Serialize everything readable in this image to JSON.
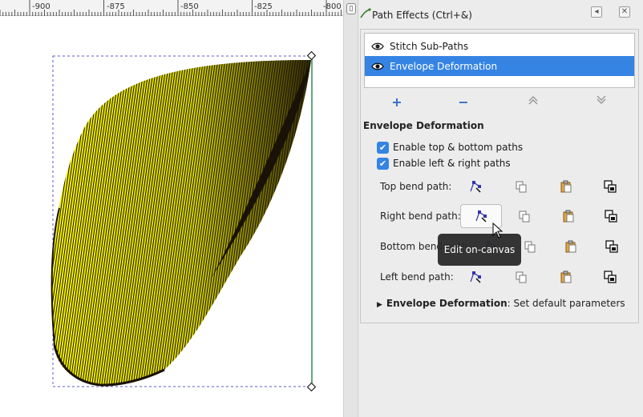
{
  "ruler": {
    "labels": [
      "-900",
      "-875",
      "-850",
      "-825",
      "-800"
    ]
  },
  "dialog": {
    "title": "Path Effects (Ctrl+&)",
    "detach_icon": "detach-icon",
    "close_icon": "close-icon",
    "effects": [
      {
        "label": "Stitch Sub-Paths",
        "visible": true,
        "selected": false
      },
      {
        "label": "Envelope Deformation",
        "visible": true,
        "selected": true
      }
    ],
    "tools": {
      "add": "+",
      "remove": "−",
      "up": "up-arrow-icon",
      "down": "down-arrow-icon"
    },
    "section_title": "Envelope Deformation",
    "checkboxes": [
      {
        "label": "Enable top & bottom paths",
        "checked": true
      },
      {
        "label": "Enable left & right paths",
        "checked": true
      }
    ],
    "bend_paths": [
      {
        "label": "Top bend path:"
      },
      {
        "label": "Right bend path:"
      },
      {
        "label": "Bottom bend path:"
      },
      {
        "label": "Left bend path:"
      }
    ],
    "expander": {
      "strong": "Envelope Deformation",
      "rest": ": Set default parameters"
    },
    "tooltip": "Edit on-canvas"
  },
  "colors": {
    "accent": "#3584e4",
    "fill": "#ffff00",
    "stroke": "#1a1207",
    "guide": "#2e8b57"
  }
}
